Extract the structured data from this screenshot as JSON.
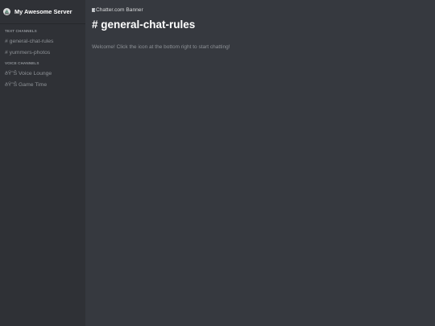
{
  "server": {
    "name": "My Awesome Server",
    "icon": "sailboat-icon"
  },
  "sidebar": {
    "text_category": "TEXT CHANNELS",
    "text_channels": [
      {
        "label": "# general-chat-rules"
      },
      {
        "label": "# yummers-photos"
      }
    ],
    "voice_category": "VOICE CHANNELS",
    "voice_channels": [
      {
        "label": "ðŸ”Š Voice Lounge"
      },
      {
        "label": "ðŸ”Š Game Time"
      }
    ]
  },
  "main": {
    "banner_alt": "Chatter.com Banner",
    "channel_title": "# general-chat-rules",
    "welcome_text": "Welcome! Click the icon at the bottom right to start chatting!"
  },
  "colors": {
    "sidebar_bg": "#2f3136",
    "main_bg": "#36393f",
    "muted_text": "#8e9297",
    "title_text": "#ffffff"
  }
}
